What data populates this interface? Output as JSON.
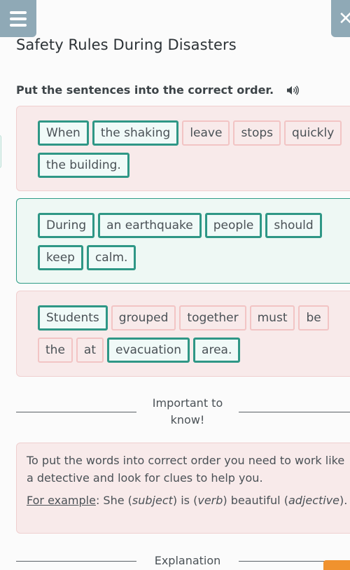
{
  "header": {
    "menu_icon": "hamburger-menu-icon",
    "close_icon": "close-icon",
    "close_glyph": "✕",
    "title": "Safety Rules During Disasters"
  },
  "task": {
    "instruction": "Put the sentences into the correct order.",
    "audio_icon": "speaker-icon"
  },
  "sentences": [
    {
      "status": "incorrect",
      "rows": [
        [
          {
            "text": "When",
            "state": "correct"
          },
          {
            "text": "the shaking",
            "state": "correct"
          },
          {
            "text": "leave",
            "state": "wrong"
          },
          {
            "text": "stops",
            "state": "wrong"
          },
          {
            "text": "quickly",
            "state": "wrong"
          }
        ],
        [
          {
            "text": "the building.",
            "state": "correct"
          }
        ]
      ]
    },
    {
      "status": "correct",
      "rows": [
        [
          {
            "text": "During",
            "state": "correct"
          },
          {
            "text": "an earthquake",
            "state": "correct"
          },
          {
            "text": "people",
            "state": "correct"
          },
          {
            "text": "should",
            "state": "correct"
          }
        ],
        [
          {
            "text": "keep",
            "state": "correct"
          },
          {
            "text": "calm.",
            "state": "correct"
          }
        ]
      ]
    },
    {
      "status": "incorrect",
      "rows": [
        [
          {
            "text": "Students",
            "state": "correct"
          },
          {
            "text": "grouped",
            "state": "wrong"
          },
          {
            "text": "together",
            "state": "wrong"
          },
          {
            "text": "must",
            "state": "wrong"
          },
          {
            "text": "be",
            "state": "wrong"
          }
        ],
        [
          {
            "text": "the",
            "state": "wrong"
          },
          {
            "text": "at",
            "state": "wrong"
          },
          {
            "text": "evacuation",
            "state": "correct"
          },
          {
            "text": "area.",
            "state": "correct"
          }
        ]
      ]
    }
  ],
  "important": {
    "heading": "Important to know!",
    "paragraph1": "To put the words into correct order you need to work like a detective and look for clues to help you.",
    "example_label": "For example",
    "example_parts": {
      "p1": ": She (",
      "subject": "subject",
      "p2": ") is (",
      "verb": "verb",
      "p3": ") beautiful (",
      "adjective": "adjective",
      "p4": ")."
    }
  },
  "explanation": {
    "heading": "Explanation"
  },
  "colors": {
    "correct_border": "#2f9786",
    "wrong_border": "#f2c4c4",
    "incorrect_box_bg": "#f8eaea",
    "correct_box_bg": "#eef8f4",
    "header_button": "#8fa9b6",
    "orange_button": "#f0922e"
  }
}
